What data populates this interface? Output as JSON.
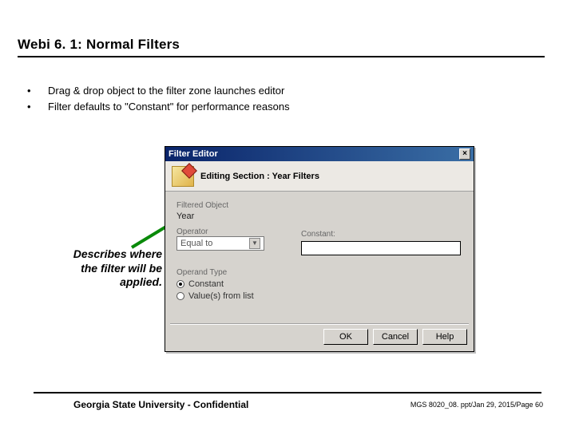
{
  "title": "Webi 6. 1: Normal Filters",
  "bullets": [
    "Drag & drop object to the filter zone launches editor",
    "Filter defaults to \"Constant\" for performance reasons"
  ],
  "callout": "Describes where the filter will be applied.",
  "dialog": {
    "titlebar": "Filter Editor",
    "header": "Editing Section : Year Filters",
    "labels": {
      "filtered_object": "Filtered Object",
      "filtered_value": "Year",
      "operator": "Operator",
      "operator_value": "Equal to",
      "constant": "Constant:",
      "operand_type": "Operand Type",
      "radio_constant": "Constant",
      "radio_values": "Value(s) from list"
    },
    "buttons": {
      "ok": "OK",
      "cancel": "Cancel",
      "help": "Help"
    }
  },
  "footer": {
    "left": "Georgia State University - Confidential",
    "right": "MGS 8020_08. ppt/Jan 29, 2015/Page 60"
  }
}
